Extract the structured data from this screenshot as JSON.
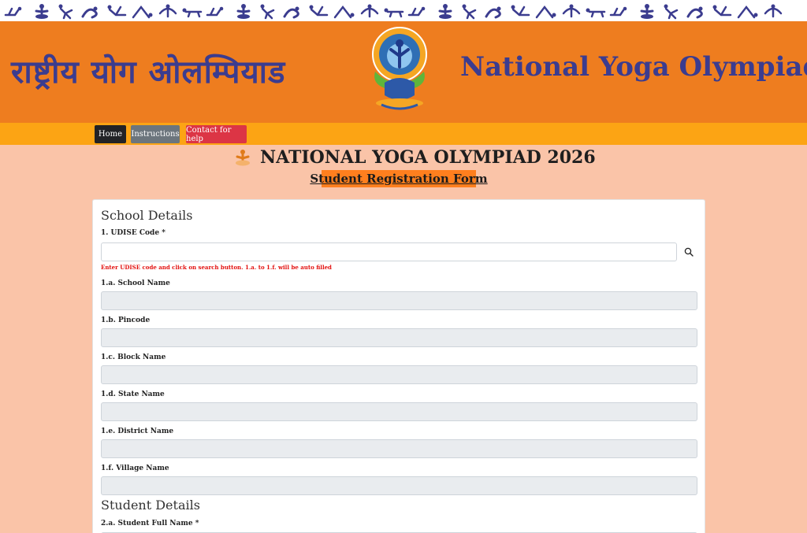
{
  "header": {
    "title_hindi": "राष्ट्रीय योग ओलम्पियाड",
    "title_english": "National Yoga Olympiad",
    "logo_icon": "international-day-of-yoga-logo",
    "strip_icon": "yoga-pose-figures"
  },
  "nav": {
    "home": "Home",
    "instructions": "Instructions",
    "contact": "Contact for help"
  },
  "page": {
    "heading": "NATIONAL YOGA OLYMPIAD 2026",
    "heading_icon": "meditation-pose-icon",
    "subtitle": "Student Registration Form"
  },
  "school_details": {
    "section_title": "School Details",
    "udise_label": "1. UDISE Code *",
    "udise_value": "",
    "udise_hint": "Enter UDISE code and click on search button. 1.a. to 1.f. will be auto filled",
    "fields": [
      {
        "label": "1.a. School Name",
        "value": ""
      },
      {
        "label": "1.b. Pincode",
        "value": ""
      },
      {
        "label": "1.c. Block Name",
        "value": ""
      },
      {
        "label": "1.d. State Name",
        "value": ""
      },
      {
        "label": "1.e. District Name",
        "value": ""
      },
      {
        "label": "1.f. Village Name",
        "value": ""
      }
    ]
  },
  "student_details": {
    "section_title": "Student Details",
    "full_name_label": "2.a. Student Full Name *"
  },
  "colors": {
    "header_bg": "#ee7d1f",
    "title_text": "#3b3c8f",
    "nav_bg": "#fca414",
    "page_bg": "#fac4a8",
    "hint_text": "#e3110f"
  }
}
